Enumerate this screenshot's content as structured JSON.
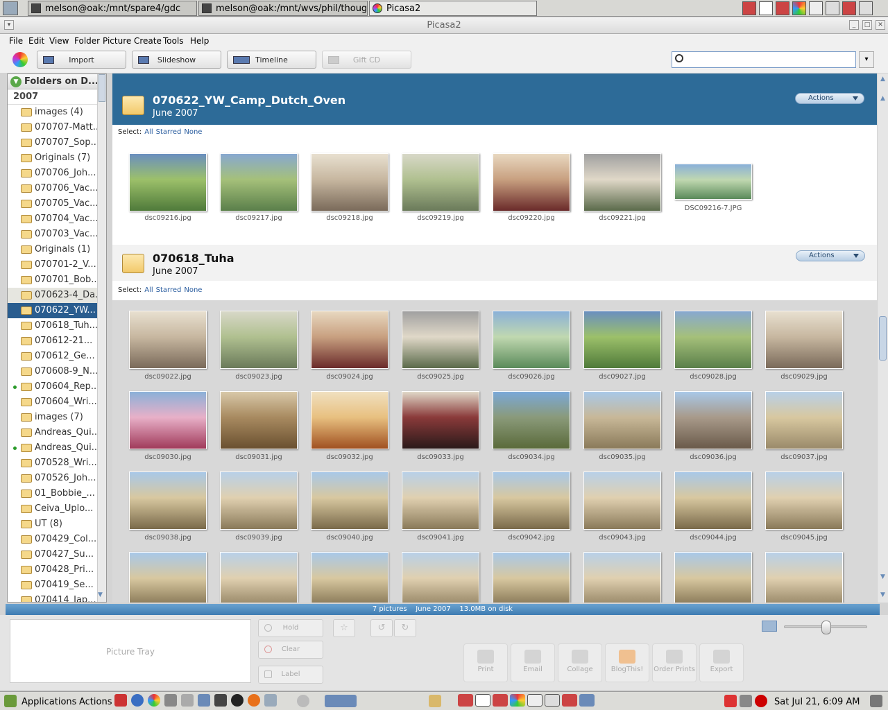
{
  "taskbar": {
    "tasks": [
      "melson@oak:/mnt/spare4/gdc",
      "melson@oak:/mnt/wvs/phil/thoughtlet",
      "Picasa2"
    ]
  },
  "window": {
    "title": "Picasa2"
  },
  "menu": [
    "File",
    "Edit",
    "View",
    "Folder",
    "Picture",
    "Create",
    "Tools",
    "Help"
  ],
  "toolbar": {
    "import": "Import",
    "slideshow": "Slideshow",
    "timeline": "Timeline",
    "giftcd": "Gift CD"
  },
  "sidebar": {
    "header": "Folders on D...",
    "year": "2007",
    "items": [
      "images (4)",
      "070707-Matt...",
      "070707_Sop...",
      "Originals (7)",
      "070706_Joh...",
      "070706_Vac...",
      "070705_Vac...",
      "070704_Vac...",
      "070703_Vac...",
      "Originals (1)",
      "070701-2_V...",
      "070701_Bob...",
      "070623-4_Da...",
      "070622_YW...",
      "070618_Tuh...",
      "070612-21...",
      "070612_Ge...",
      "070608-9_N...",
      "070604_Rep...",
      "070604_Wri...",
      "images (7)",
      "Andreas_Qui...",
      "Andreas_Qui...",
      "070528_Wri...",
      "070526_Joh...",
      "01_Bobbie_...",
      "Ceiva_Uplo...",
      "UT (8)",
      "070429_Col...",
      "070427_Su...",
      "070428_Pri...",
      "070419_Se...",
      "070414_Jap..."
    ]
  },
  "groups": [
    {
      "title": "070622_YW_Camp_Dutch_Oven",
      "date": "June 2007",
      "actions": "Actions",
      "select": {
        "label": "Select:",
        "all": "All",
        "starred": "Starred",
        "none": "None"
      },
      "photos": [
        "dsc09216.jpg",
        "dsc09217.jpg",
        "dsc09218.jpg",
        "dsc09219.jpg",
        "dsc09220.jpg",
        "dsc09221.jpg",
        "DSC09216-7.JPG"
      ]
    },
    {
      "title": "070618_Tuha",
      "date": "June 2007",
      "actions": "Actions",
      "select": {
        "label": "Select:",
        "all": "All",
        "starred": "Starred",
        "none": "None"
      },
      "photos": [
        "dsc09022.jpg",
        "dsc09023.jpg",
        "dsc09024.jpg",
        "dsc09025.jpg",
        "dsc09026.jpg",
        "dsc09027.jpg",
        "dsc09028.jpg",
        "dsc09029.jpg",
        "dsc09030.jpg",
        "dsc09031.jpg",
        "dsc09032.jpg",
        "dsc09033.jpg",
        "dsc09034.jpg",
        "dsc09035.jpg",
        "dsc09036.jpg",
        "dsc09037.jpg",
        "dsc09038.jpg",
        "dsc09039.jpg",
        "dsc09040.jpg",
        "dsc09041.jpg",
        "dsc09042.jpg",
        "dsc09043.jpg",
        "dsc09044.jpg",
        "dsc09045.jpg",
        "",
        "",
        "",
        "",
        "",
        "",
        "",
        ""
      ]
    }
  ],
  "status": {
    "pictures": "7 pictures",
    "date": "June 2007",
    "size": "13.0MB on disk"
  },
  "tray": {
    "label": "Picture Tray",
    "hold": "Hold",
    "clear": "Clear",
    "label_btn": "Label"
  },
  "export_buttons": [
    "Print",
    "Email",
    "Collage",
    "BlogThis!",
    "Order Prints",
    "Export"
  ],
  "panel": {
    "applications": "Applications",
    "actions": "Actions",
    "clock": "Sat Jul 21,  6:09 AM"
  },
  "colors": {
    "accent": "#2d6b98",
    "status": "#3e7cb2"
  }
}
